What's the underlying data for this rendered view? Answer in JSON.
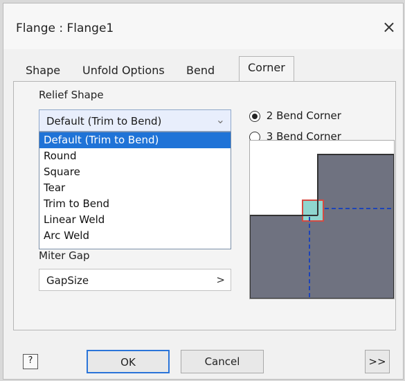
{
  "window": {
    "title": "Flange : Flange1",
    "close": "×"
  },
  "tabs": [
    "Shape",
    "Unfold Options",
    "Bend",
    "Corner"
  ],
  "corner": {
    "relief_shape_label": "Relief Shape",
    "combo_selected": "Default (Trim to Bend)",
    "combo_arrow": "⌄",
    "dropdown_options": [
      "Default (Trim to Bend)",
      "Round",
      "Square",
      "Tear",
      "Trim to Bend",
      "Linear Weld",
      "Arc Weld"
    ],
    "radio_2": "2 Bend Corner",
    "radio_3": "3 Bend Corner",
    "miter_gap_label": "Miter Gap",
    "miter_value": "GapSize",
    "miter_btn": ">"
  },
  "footer": {
    "help": "?",
    "ok": "OK",
    "cancel": "Cancel",
    "more": ">>"
  }
}
